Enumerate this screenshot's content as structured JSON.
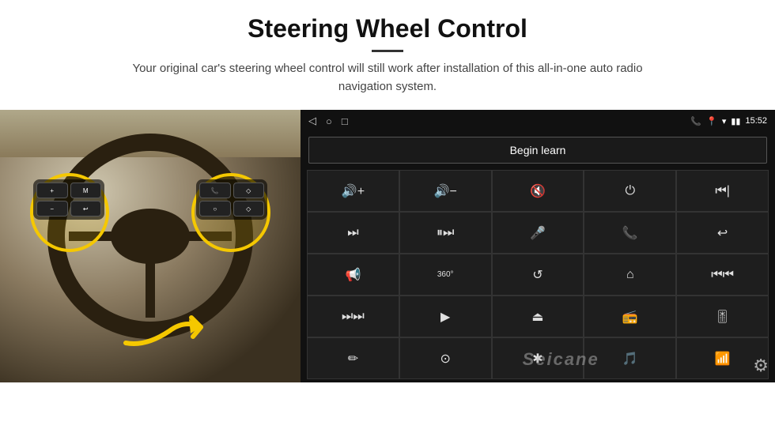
{
  "header": {
    "title": "Steering Wheel Control",
    "subtitle": "Your original car's steering wheel control will still work after installation of this all-in-one auto radio navigation system."
  },
  "status_bar": {
    "time": "15:52",
    "nav_icons": [
      "◁",
      "○",
      "□"
    ]
  },
  "begin_learn_btn": "Begin learn",
  "control_buttons": [
    {
      "icon": "🔊+",
      "label": "vol-up"
    },
    {
      "icon": "🔊−",
      "label": "vol-down"
    },
    {
      "icon": "🔇",
      "label": "mute"
    },
    {
      "icon": "⏻",
      "label": "power"
    },
    {
      "icon": "⏮",
      "label": "prev-end"
    },
    {
      "icon": "⏭",
      "label": "next"
    },
    {
      "icon": "⏸",
      "label": "pause"
    },
    {
      "icon": "🎤",
      "label": "mic"
    },
    {
      "icon": "📞",
      "label": "call"
    },
    {
      "icon": "↩",
      "label": "hang-up"
    },
    {
      "icon": "📢",
      "label": "speaker"
    },
    {
      "icon": "360°",
      "label": "360"
    },
    {
      "icon": "↺",
      "label": "back"
    },
    {
      "icon": "🏠",
      "label": "home"
    },
    {
      "icon": "⏮⏮",
      "label": "rewind"
    },
    {
      "icon": "⏭⏭",
      "label": "fast-forward"
    },
    {
      "icon": "▶",
      "label": "nav"
    },
    {
      "icon": "⏏",
      "label": "eject"
    },
    {
      "icon": "📻",
      "label": "radio"
    },
    {
      "icon": "🎚",
      "label": "eq"
    },
    {
      "icon": "✏",
      "label": "draw"
    },
    {
      "icon": "⚙",
      "label": "settings2"
    },
    {
      "icon": "✱",
      "label": "bluetooth"
    },
    {
      "icon": "🎵",
      "label": "music"
    },
    {
      "icon": "📊",
      "label": "spectrum"
    }
  ],
  "seicane_text": "Seicane",
  "gear_icon": "⚙"
}
